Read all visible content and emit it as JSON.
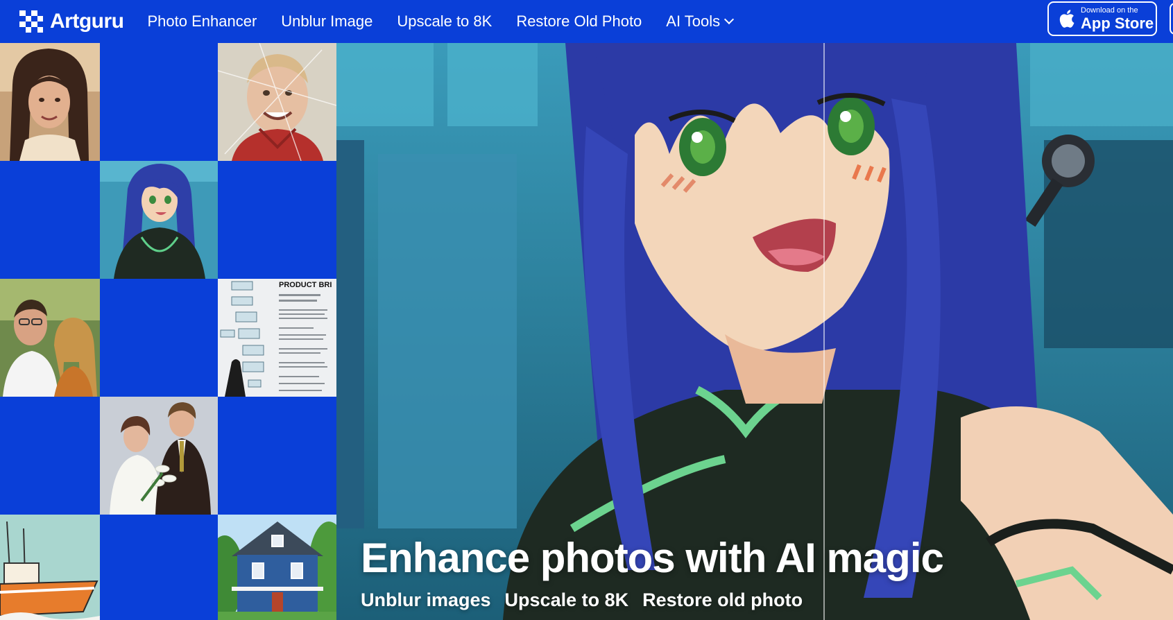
{
  "brand": {
    "name": "Artguru"
  },
  "nav": {
    "items": [
      {
        "label": "Photo Enhancer"
      },
      {
        "label": "Unblur Image"
      },
      {
        "label": "Upscale to 8K"
      },
      {
        "label": "Restore Old Photo"
      },
      {
        "label": "AI Tools",
        "has_dropdown": true
      }
    ]
  },
  "appstore": {
    "small": "Download on the",
    "big": "App Store"
  },
  "gallery": {
    "tiles": [
      {
        "name": "portrait-woman-photo"
      },
      {
        "name": "blank"
      },
      {
        "name": "old-boy-photo"
      },
      {
        "name": "blank"
      },
      {
        "name": "anime-girl-thumb"
      },
      {
        "name": "blank"
      },
      {
        "name": "couple-photo"
      },
      {
        "name": "blank"
      },
      {
        "name": "document-photo",
        "doc_title": "PRODUCT BRI"
      },
      {
        "name": "blank"
      },
      {
        "name": "wedding-photo"
      },
      {
        "name": "blank"
      },
      {
        "name": "boat-illustration"
      },
      {
        "name": "blank"
      },
      {
        "name": "house-photo"
      }
    ]
  },
  "hero": {
    "title": "Enhance photos with AI magic",
    "links": [
      "Unblur images",
      "Upscale to 8K",
      "Restore old photo"
    ]
  },
  "colors": {
    "brand_blue": "#0a3fd8",
    "text": "#ffffff"
  }
}
